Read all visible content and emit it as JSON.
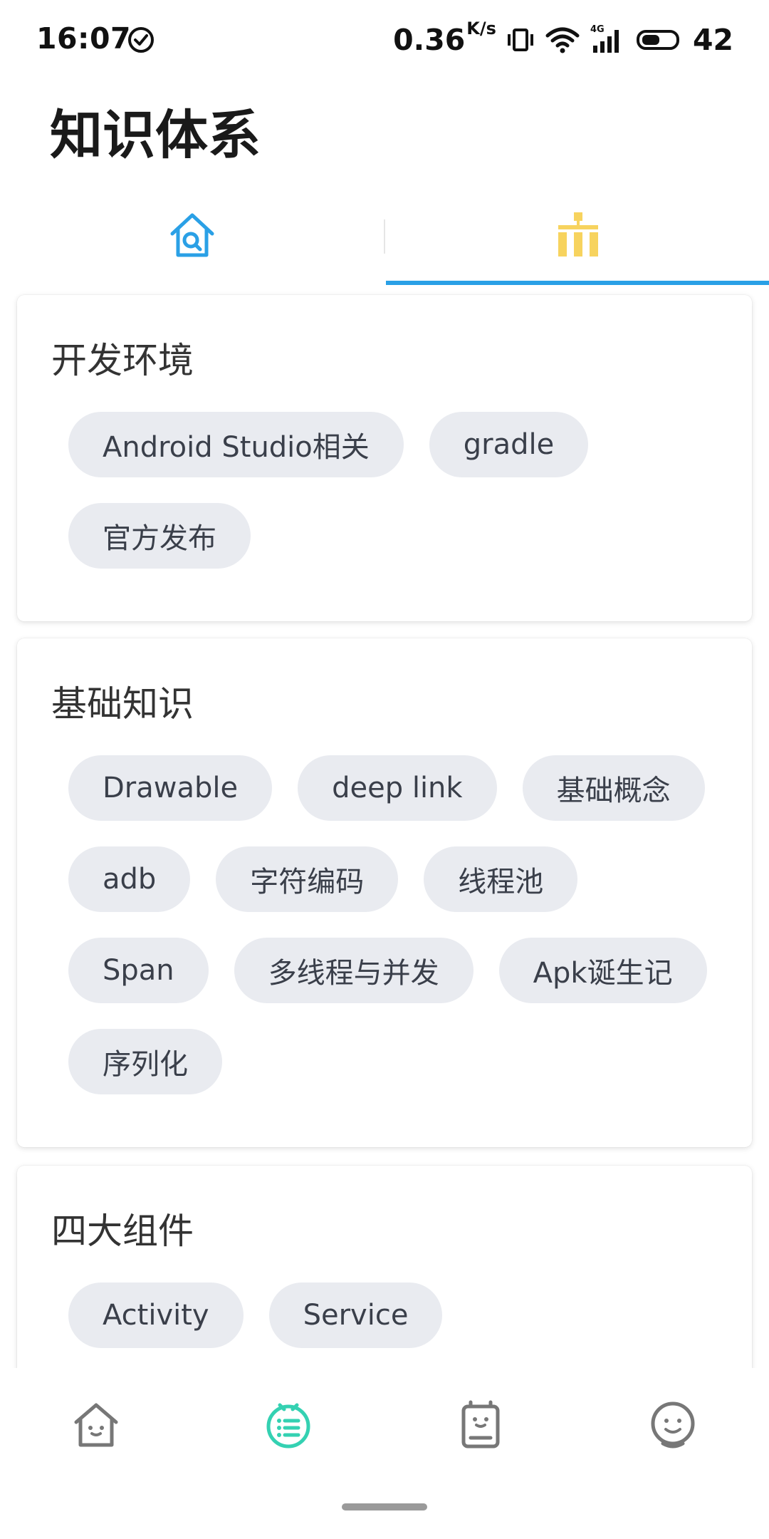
{
  "status_bar": {
    "time": "16:07",
    "speed": "0.36",
    "speed_unit": "K/s",
    "network": "4G",
    "battery": "42"
  },
  "header": {
    "title": "知识体系"
  },
  "tabs": [
    {
      "name": "search-home",
      "icon": "home-search-icon",
      "active": false
    },
    {
      "name": "knowledge-tree",
      "icon": "tree-hierarchy-icon",
      "active": true
    }
  ],
  "sections": [
    {
      "title": "开发环境",
      "tags": [
        "Android Studio相关",
        "gradle",
        "官方发布"
      ]
    },
    {
      "title": "基础知识",
      "tags": [
        "Drawable",
        "deep link",
        "基础概念",
        "adb",
        "字符编码",
        "线程池",
        "Span",
        "多线程与并发",
        "Apk诞生记",
        "序列化"
      ]
    },
    {
      "title": "四大组件",
      "tags": [
        "Activity",
        "Service"
      ]
    }
  ],
  "bottom_nav": [
    {
      "name": "home",
      "icon": "home-face-icon",
      "active": false
    },
    {
      "name": "system",
      "icon": "list-circle-icon",
      "active": true
    },
    {
      "name": "project",
      "icon": "board-face-icon",
      "active": false
    },
    {
      "name": "mine",
      "icon": "smiley-face-icon",
      "active": false
    }
  ],
  "colors": {
    "accent_blue": "#2aa0e6",
    "tree_yellow": "#f7d35e",
    "nav_active": "#34d1b2",
    "nav_inactive": "#777777",
    "chip_bg": "#e9ebf0"
  }
}
